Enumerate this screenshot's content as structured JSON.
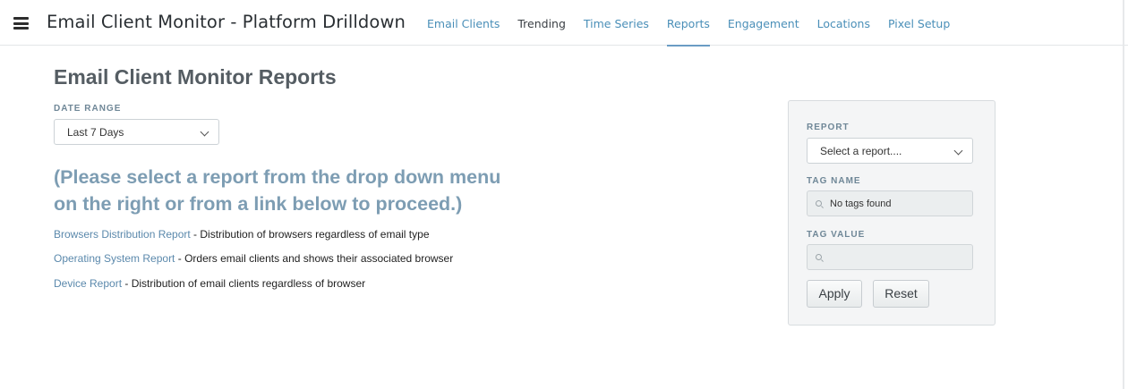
{
  "header": {
    "menu_icon": "hamburger-menu-icon",
    "title": "Email Client Monitor - Platform Drilldown",
    "tabs": [
      {
        "label": "Email Clients",
        "active": false
      },
      {
        "label": "Trending",
        "active": false
      },
      {
        "label": "Time Series",
        "active": false
      },
      {
        "label": "Reports",
        "active": true
      },
      {
        "label": "Engagement",
        "active": false
      },
      {
        "label": "Locations",
        "active": false
      },
      {
        "label": "Pixel Setup",
        "active": false
      }
    ]
  },
  "main": {
    "title": "Email Client Monitor Reports",
    "date_range": {
      "label": "DATE RANGE",
      "value": "Last 7 Days"
    },
    "prompt_line1": "(Please select a report from the drop down menu",
    "prompt_line2": "on the right or from a link below to proceed.)",
    "reports": [
      {
        "link": "Browsers Distribution Report",
        "description": " - Distribution of browsers regardless of email type"
      },
      {
        "link": "Operating System Report",
        "description": " - Orders email clients and shows their associated browser"
      },
      {
        "link": "Device Report",
        "description": " - Distribution of email clients regardless of browser"
      }
    ]
  },
  "panel": {
    "report_label": "REPORT",
    "report_value": "Select a report....",
    "tag_name_label": "TAG NAME",
    "tag_name_placeholder": "No tags found",
    "tag_value_label": "TAG VALUE",
    "tag_value_value": "",
    "apply_label": "Apply",
    "reset_label": "Reset"
  },
  "colors": {
    "link": "#5b89ac",
    "prompt": "#7d9db3",
    "title": "#555d63",
    "panel_bg": "#f4f5f6"
  }
}
